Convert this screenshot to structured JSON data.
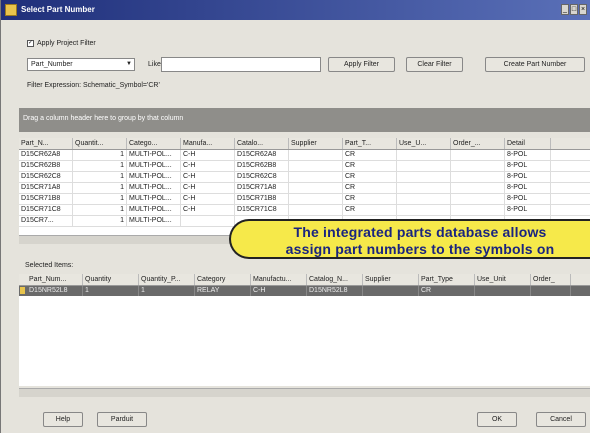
{
  "window": {
    "title": "Select Part Number",
    "controls": [
      "_",
      "□",
      "×"
    ]
  },
  "apply_filter": {
    "label": "Apply Project Filter",
    "checked": true
  },
  "field_select": {
    "value": "Part_Number"
  },
  "like": {
    "label": "Like:",
    "value": ""
  },
  "buttons": {
    "apply_filter": "Apply Filter",
    "clear_filter": "Clear Filter",
    "create_part": "Create Part Number",
    "help": "Help",
    "parduit": "Parduit",
    "ok": "OK",
    "cancel": "Cancel"
  },
  "filter_expression": "Filter Expression: Schematic_Symbol='CR'",
  "group_hint": "Drag a column header here to group by that column",
  "table": {
    "headers": [
      "Part_N...",
      "Quantit...",
      "Catego...",
      "Manufa...",
      "Catalo...",
      "Supplier",
      "Part_T...",
      "Use_U...",
      "Order_...",
      "Detail"
    ],
    "rows": [
      [
        "D15CR62A8",
        "1",
        "MULTI-POL...",
        "C-H",
        "D15CR62A8",
        "",
        "CR",
        "",
        "",
        "8-POL"
      ],
      [
        "D15CR62B8",
        "1",
        "MULTI-POL...",
        "C-H",
        "D15CR62B8",
        "",
        "CR",
        "",
        "",
        "8-POL"
      ],
      [
        "D15CR62C8",
        "1",
        "MULTI-POL...",
        "C-H",
        "D15CR62C8",
        "",
        "CR",
        "",
        "",
        "8-POL"
      ],
      [
        "D15CR71A8",
        "1",
        "MULTI-POL...",
        "C-H",
        "D15CR71A8",
        "",
        "CR",
        "",
        "",
        "8-POL"
      ],
      [
        "D15CR71B8",
        "1",
        "MULTI-POL...",
        "C-H",
        "D15CR71B8",
        "",
        "CR",
        "",
        "",
        "8-POL"
      ],
      [
        "D15CR71C8",
        "1",
        "MULTI-POL...",
        "C-H",
        "D15CR71C8",
        "",
        "CR",
        "",
        "",
        "8-POL"
      ],
      [
        "D15CR7...",
        "1",
        "MULTI-POL...",
        "",
        "",
        "",
        "",
        "",
        "",
        ""
      ]
    ]
  },
  "callout": {
    "line1": "The integrated parts database allows",
    "line2": "assign part numbers to the symbols on"
  },
  "selected": {
    "label": "Selected Items:",
    "headers": [
      "Part_Num...",
      "Quantity",
      "Quantity_P...",
      "Category",
      "Manufactu...",
      "Catalog_N...",
      "Supplier",
      "Part_Type",
      "Use_Unit",
      "Order_"
    ],
    "row": [
      "D15NR52L8",
      "1",
      "1",
      "RELAY",
      "C-H",
      "D15NR52L8",
      "",
      "CR",
      "",
      ""
    ]
  }
}
